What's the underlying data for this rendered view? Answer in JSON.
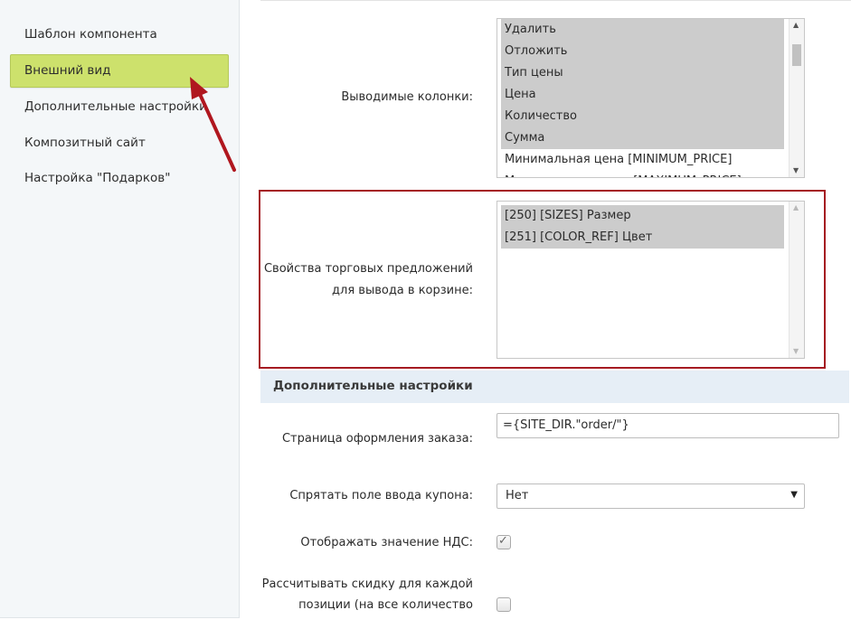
{
  "sidebar": {
    "items": [
      {
        "label": "Шаблон компонента"
      },
      {
        "label": "Внешний вид",
        "active": true
      },
      {
        "label": "Дополнительные настройки"
      },
      {
        "label": "Композитный сайт"
      },
      {
        "label": "Настройка \"Подарков\""
      }
    ]
  },
  "columns": {
    "label": "Выводимые колонки:",
    "options": [
      {
        "text": "Удалить",
        "selected": true
      },
      {
        "text": "Отложить",
        "selected": true
      },
      {
        "text": "Тип цены",
        "selected": true
      },
      {
        "text": "Цена",
        "selected": true
      },
      {
        "text": "Количество",
        "selected": true
      },
      {
        "text": "Сумма",
        "selected": true
      },
      {
        "text": "Минимальная цена [MINIMUM_PRICE]",
        "selected": false
      },
      {
        "text": "Максимальная цена [MAXIMUM_PRICE]",
        "selected": false
      }
    ]
  },
  "offer_props": {
    "label_line1": "Свойства торговых предложений",
    "label_line2": "для вывода в корзине:",
    "options": [
      {
        "text": "[250] [SIZES] Размер",
        "selected": true
      },
      {
        "text": "[251] [COLOR_REF] Цвет",
        "selected": true
      }
    ]
  },
  "extra": {
    "section_title": "Дополнительные настройки",
    "order_page_label": "Страница оформления заказа:",
    "order_page_value": "={SITE_DIR.\"order/\"}",
    "hide_coupon_label": "Спрятать поле ввода купона:",
    "hide_coupon_value": "Нет",
    "show_vat_label": "Отображать значение НДС:",
    "show_vat_checked": true,
    "discount_label_line1": "Рассчитывать скидку для каждой",
    "discount_label_line2": "позиции (на все количество",
    "discount_checked": false
  },
  "colors": {
    "active_item": "#cde16c",
    "highlight_border": "#a51b21",
    "arrow": "#b0171f",
    "section_bg": "#e6eef6"
  }
}
